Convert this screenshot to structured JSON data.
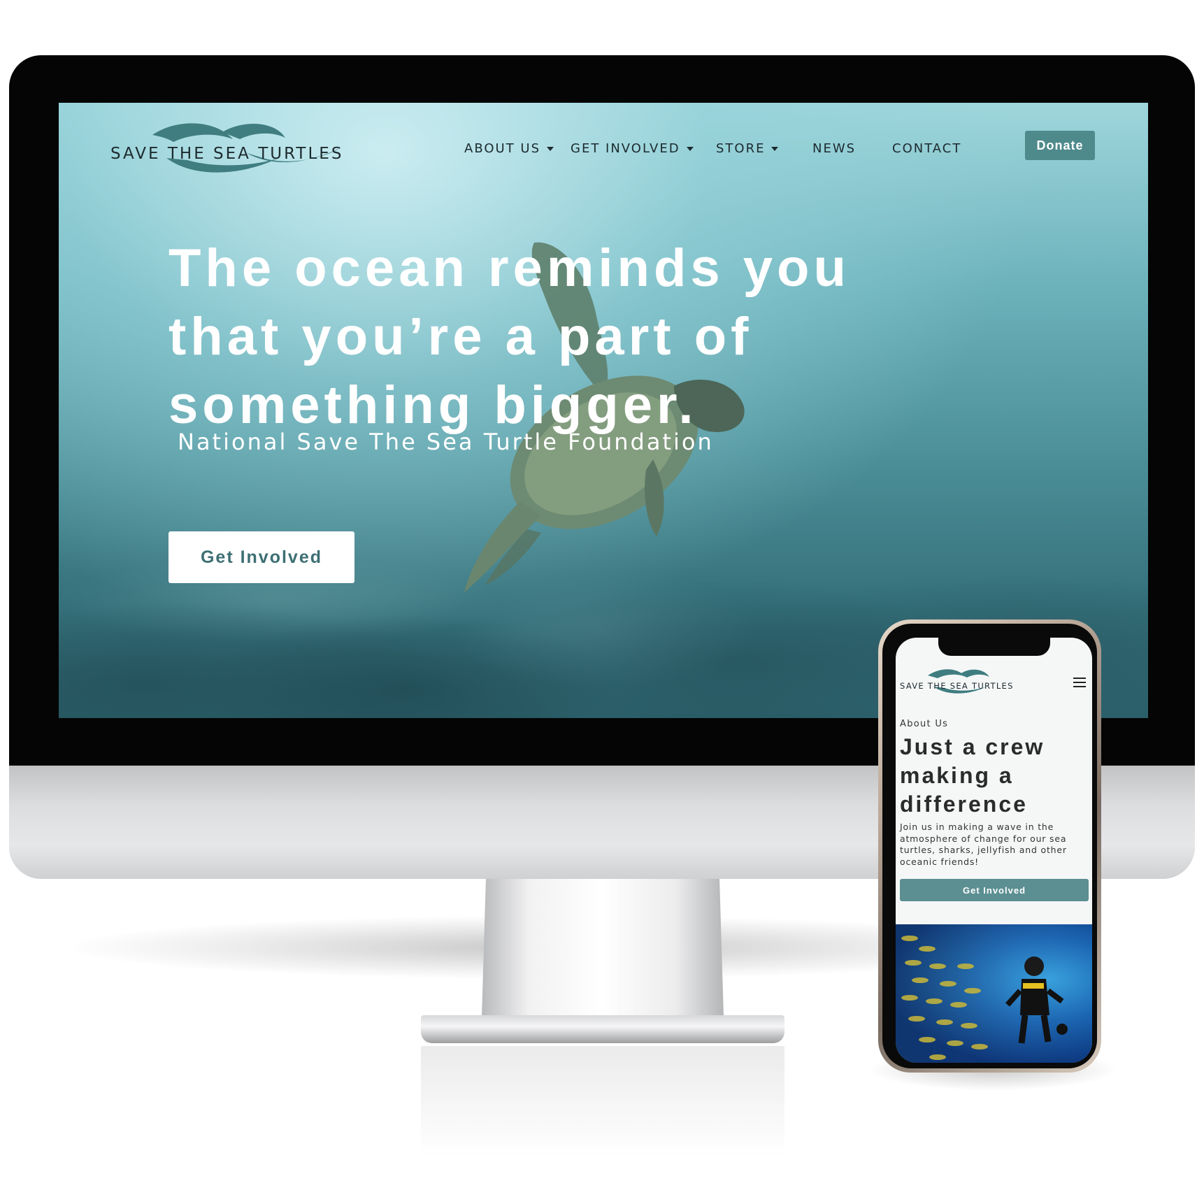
{
  "desktop": {
    "logo_text": "SAVE THE SEA TURTLES",
    "nav": {
      "items": [
        {
          "label": "ABOUT US",
          "has_dropdown": true
        },
        {
          "label": "GET INVOLVED",
          "has_dropdown": true
        },
        {
          "label": "STORE",
          "has_dropdown": true
        },
        {
          "label": "NEWS",
          "has_dropdown": false
        },
        {
          "label": "CONTACT",
          "has_dropdown": false
        }
      ],
      "donate_label": "Donate"
    },
    "hero": {
      "title_lines": [
        "The ocean reminds you",
        "that you’re a part of",
        "something bigger."
      ],
      "subtitle": "National Save The Sea Turtle Foundation",
      "cta_label": "Get Involved"
    }
  },
  "mobile": {
    "logo_text": "SAVE THE SEA TURTLES",
    "menu_icon": "hamburger-icon",
    "eyebrow": "About Us",
    "title_lines": [
      "Just a crew",
      "making a",
      "difference"
    ],
    "body_lines": [
      "Join us in making a wave in the",
      "atmosphere of change for our sea",
      "turtles, sharks, jellyfish and other",
      "oceanic friends!"
    ],
    "cta_label": "Get Involved"
  },
  "colors": {
    "accent": "#4e8a8c",
    "mobile_button": "#5c8f92",
    "logo_wave": "#3f7d80",
    "text_dark": "#1c2a2e"
  }
}
